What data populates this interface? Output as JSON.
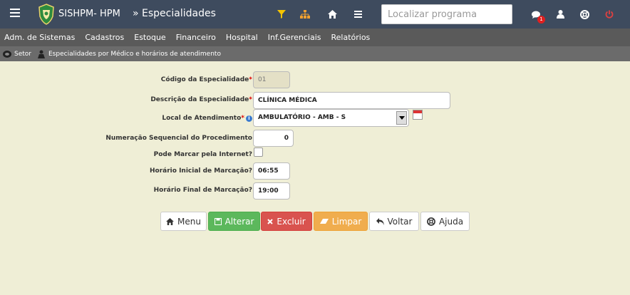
{
  "header": {
    "brand": "SISHPM- HPM",
    "breadcrumb": "» Especialidades",
    "search_placeholder": "Localizar programa",
    "notification_count": "1"
  },
  "menu": [
    "Adm. de Sistemas",
    "Cadastros",
    "Estoque",
    "Financeiro",
    "Hospital",
    "Inf.Gerenciais",
    "Relatórios"
  ],
  "subnav": {
    "item1": "Setor",
    "item2": "Especialidades por Médico e horários de atendimento"
  },
  "form": {
    "codigo": {
      "label": "Código da Especialidade",
      "value": "01"
    },
    "descricao": {
      "label": "Descrição da Especialidade",
      "value": "CLÍNICA MÉDICA"
    },
    "local": {
      "label": "Local de Atendimento",
      "value": "AMBULATÓRIO - AMB - S"
    },
    "numeracao": {
      "label": "Numeração Sequencial do Procedimento",
      "value": "0"
    },
    "internet": {
      "label": "Pode Marcar pela Internet?"
    },
    "inicial": {
      "label": "Horário Inicial de Marcação?",
      "value": "06:55"
    },
    "final": {
      "label": "Horário Final de Marcação?",
      "value": "19:00"
    }
  },
  "buttons": {
    "menu": "Menu",
    "alterar": "Alterar",
    "excluir": "Excluir",
    "limpar": "Limpar",
    "voltar": "Voltar",
    "ajuda": "Ajuda"
  },
  "colors": {
    "topbar": "#3e4b5e",
    "background": "#efeed6",
    "success": "#5cb85c",
    "danger": "#d9534f",
    "warning": "#f0ad4e",
    "logo_green": "#2e8b3e",
    "filter_yellow": "#f5c400"
  },
  "icons": [
    "hamburger-icon",
    "filter-icon",
    "sitemap-icon",
    "home-icon",
    "list-icon",
    "comments-icon",
    "user-icon",
    "help-lifering-icon",
    "power-icon"
  ]
}
